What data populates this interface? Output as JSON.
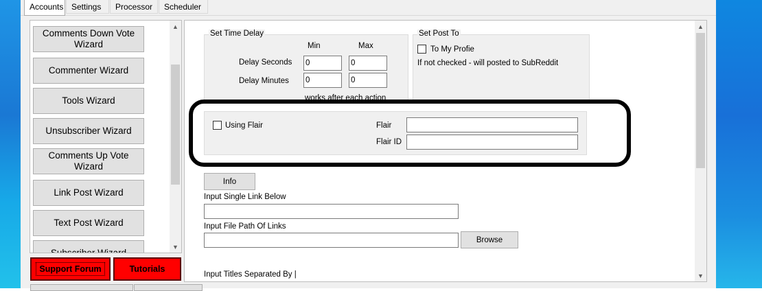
{
  "tabs": [
    {
      "label": "Accounts",
      "active": true
    },
    {
      "label": "Settings",
      "active": false
    },
    {
      "label": "Processor",
      "active": false
    },
    {
      "label": "Scheduler",
      "active": false
    }
  ],
  "sidebar": {
    "items": [
      {
        "label": "Comments Down Vote Wizard"
      },
      {
        "label": "Commenter Wizard"
      },
      {
        "label": "Tools Wizard"
      },
      {
        "label": "Unsubscriber Wizard"
      },
      {
        "label": "Comments Up Vote Wizard"
      },
      {
        "label": "Link Post Wizard"
      },
      {
        "label": "Text Post Wizard"
      },
      {
        "label": "Subscriber Wizard"
      }
    ],
    "support_label": "Support Forum",
    "tutorials_label": "Tutorials"
  },
  "delay": {
    "title": "Set Time Delay",
    "min_header": "Min",
    "max_header": "Max",
    "seconds_label": "Delay Seconds",
    "minutes_label": "Delay Minutes",
    "seconds_min": "0",
    "seconds_max": "0",
    "minutes_min": "0",
    "minutes_max": "0",
    "note": "works after each action"
  },
  "post_to": {
    "title": "Set Post To",
    "checkbox_label": "To My Profie",
    "checked": false,
    "note": "If not checked - will posted to SubReddit"
  },
  "flair": {
    "checkbox_label": "Using Flair",
    "checked": false,
    "flair_label": "Flair",
    "flair_value": "",
    "flair_id_label": "Flair ID",
    "flair_id_value": ""
  },
  "main": {
    "info_label": "Info",
    "single_link_label": "Input Single Link Below",
    "single_link_value": "",
    "file_path_label": "Input File Path Of  Links",
    "file_path_value": "",
    "browse_label": "Browse",
    "titles_label": "Input Titles Separated By |"
  },
  "colors": {
    "accent_red": "#ff0000",
    "highlight": "#000000",
    "desktop_blue": "#1a7fd6"
  }
}
